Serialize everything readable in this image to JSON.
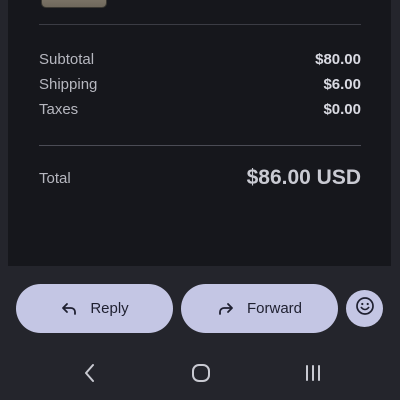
{
  "summary": {
    "subtotal_label": "Subtotal",
    "subtotal_value": "$80.00",
    "shipping_label": "Shipping",
    "shipping_value": "$6.00",
    "taxes_label": "Taxes",
    "taxes_value": "$0.00",
    "total_label": "Total",
    "total_value": "$86.00 USD"
  },
  "actions": {
    "reply_label": "Reply",
    "forward_label": "Forward",
    "reply_icon": "reply-arrow-icon",
    "forward_icon": "forward-arrow-icon",
    "emoji_icon": "emoji-reaction-icon"
  },
  "nav": {
    "back_icon": "back-chevron-icon",
    "home_icon": "home-circle-icon",
    "recents_icon": "recents-bars-icon"
  },
  "colors": {
    "background": "#24252c",
    "card": "#16171c",
    "pill": "#c4c6e4"
  }
}
